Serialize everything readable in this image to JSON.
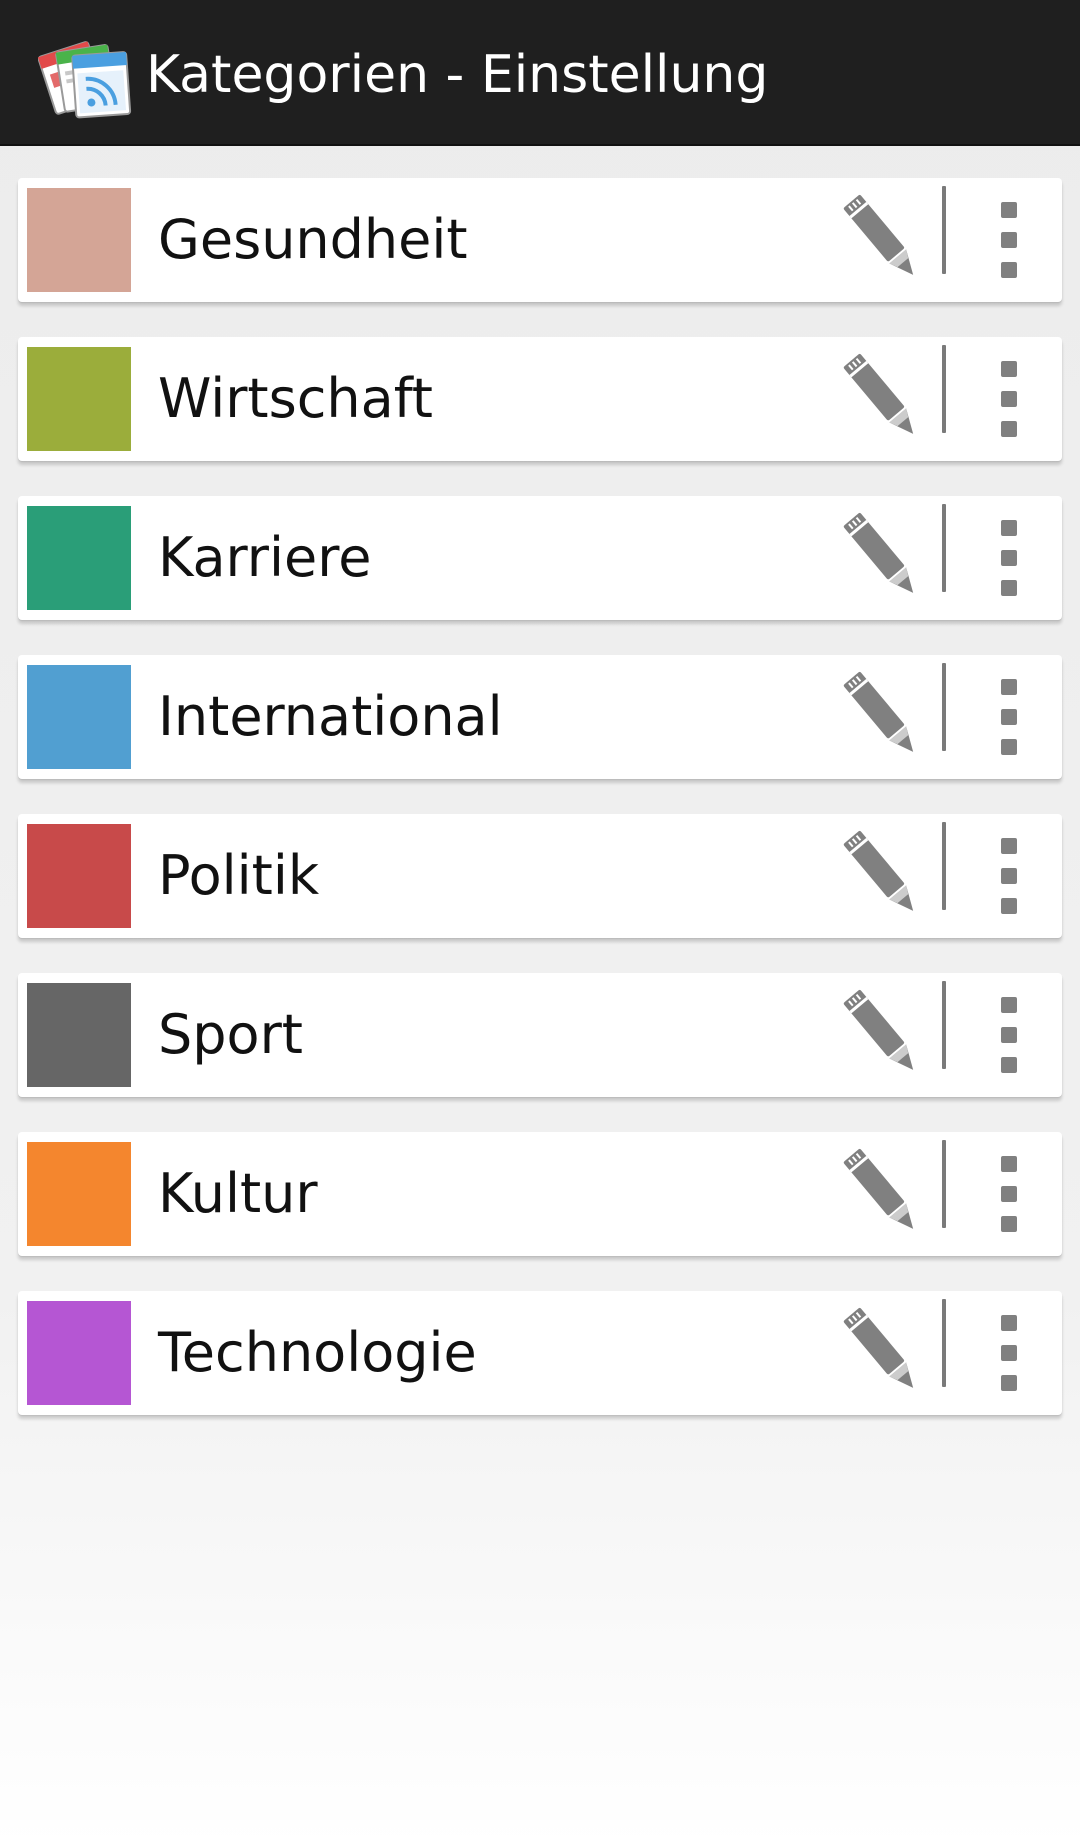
{
  "app": {
    "title": "Kategorien - Einstellung",
    "icon": "rss-news-app-icon"
  },
  "categories": [
    {
      "label": "Gesundheit",
      "color": "#d4a596"
    },
    {
      "label": "Wirtschaft",
      "color": "#9bad3b"
    },
    {
      "label": "Karriere",
      "color": "#2a9e78"
    },
    {
      "label": "International",
      "color": "#519fd1"
    },
    {
      "label": "Politik",
      "color": "#c84a4a"
    },
    {
      "label": "Sport",
      "color": "#666666"
    },
    {
      "label": "Kultur",
      "color": "#f4862e"
    },
    {
      "label": "Technologie",
      "color": "#b556d3"
    }
  ],
  "icons": {
    "edit": "pencil-icon",
    "menu": "overflow-menu-icon"
  },
  "theme": {
    "actionbar_bg": "#1f1f1f",
    "icon_gray": "#808080"
  }
}
